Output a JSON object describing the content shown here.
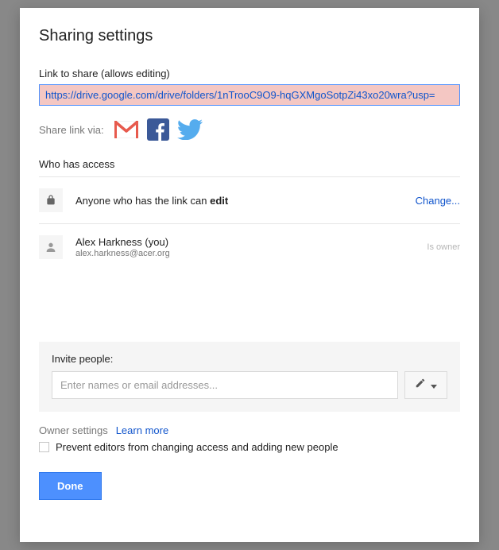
{
  "dialog": {
    "title": "Sharing settings"
  },
  "link": {
    "label": "Link to share (allows editing)",
    "url": "https://drive.google.com/drive/folders/1nTrooC9O9-hqGXMgoSotpZi43xo20wra?usp="
  },
  "share_via": {
    "label": "Share link via:"
  },
  "access": {
    "heading": "Who has access",
    "anyone": {
      "text_before": "Anyone who has the link can ",
      "text_bold": "edit",
      "change": "Change..."
    },
    "owner": {
      "name": "Alex Harkness (you)",
      "email": "alex.harkness@acer.org",
      "role": "Is owner"
    }
  },
  "invite": {
    "label": "Invite people:",
    "placeholder": "Enter names or email addresses..."
  },
  "owner_settings": {
    "label": "Owner settings",
    "learn_more": "Learn more",
    "prevent_label": "Prevent editors from changing access and adding new people"
  },
  "buttons": {
    "done": "Done"
  }
}
